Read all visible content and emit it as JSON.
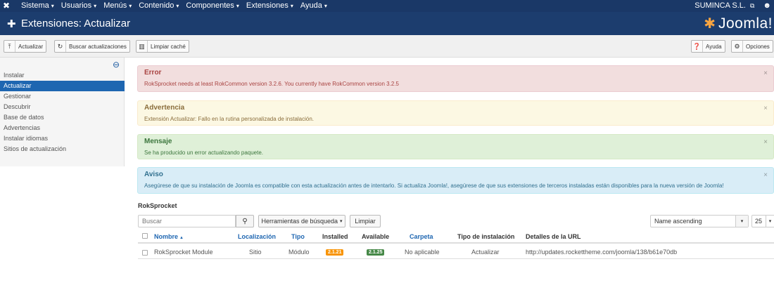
{
  "topnav": {
    "menu": [
      {
        "label": "Sistema"
      },
      {
        "label": "Usuarios"
      },
      {
        "label": "Menús"
      },
      {
        "label": "Contenido"
      },
      {
        "label": "Componentes"
      },
      {
        "label": "Extensiones"
      },
      {
        "label": "Ayuda"
      }
    ],
    "site_name": "SUMINCA S.L.",
    "caret": "▾"
  },
  "header": {
    "title": "Extensiones: Actualizar",
    "brand": "Joomla!"
  },
  "toolbar": {
    "update_label": "Actualizar",
    "find_updates_label": "Buscar actualizaciones",
    "clear_cache_label": "Limpiar caché",
    "help_label": "Ayuda",
    "options_label": "Opciones"
  },
  "sidebar": {
    "items": [
      {
        "label": "Instalar"
      },
      {
        "label": "Actualizar"
      },
      {
        "label": "Gestionar"
      },
      {
        "label": "Descubrir"
      },
      {
        "label": "Base de datos"
      },
      {
        "label": "Advertencias"
      },
      {
        "label": "Instalar idiomas"
      },
      {
        "label": "Sitios de actualización"
      }
    ]
  },
  "alerts": {
    "error": {
      "title": "Error",
      "text": "RokSprocket needs at least RokCommon version 3.2.6. You currently have RokCommon version 3.2.5"
    },
    "warning": {
      "title": "Advertencia",
      "text": "Extensión Actualizar: Fallo en la rutina personalizada de instalación."
    },
    "message": {
      "title": "Mensaje",
      "text": "Se ha producido un error actualizando paquete."
    },
    "notice": {
      "title": "Aviso",
      "text": "Asegúrese de que su instalación de Joomla es compatible con esta actualización antes de intentarlo. Si actualiza Joomla!, asegúrese de que sus extensiones de terceros instaladas están disponibles para la nueva versión de Joomla!"
    },
    "close_symbol": "×"
  },
  "main": {
    "section_title": "RokSprocket",
    "search_placeholder": "Buscar",
    "search_tools_label": "Herramientas de búsqueda",
    "clear_label": "Limpiar",
    "ordering": "Name ascending",
    "limit": "25"
  },
  "table": {
    "headers": {
      "name": "Nombre",
      "location": "Localización",
      "type": "Tipo",
      "installed": "Installed",
      "available": "Available",
      "folder": "Carpeta",
      "install_type": "Tipo de instalación",
      "url_details": "Detalles de la URL"
    },
    "rows": [
      {
        "name": "RokSprocket Module",
        "location": "Sitio",
        "type": "Módulo",
        "installed": "2.1.21",
        "available": "2.1.25",
        "folder": "No aplicable",
        "install_type": "Actualizar",
        "url": "http://updates.rockettheme.com/joomla/138/b61e70db"
      }
    ]
  },
  "colors": {
    "topnav_bg": "#1a3867",
    "header_bg": "#1c3d6e",
    "active_sidebar": "#1e66b1",
    "installed_badge": "#f89406",
    "available_badge": "#468847"
  }
}
